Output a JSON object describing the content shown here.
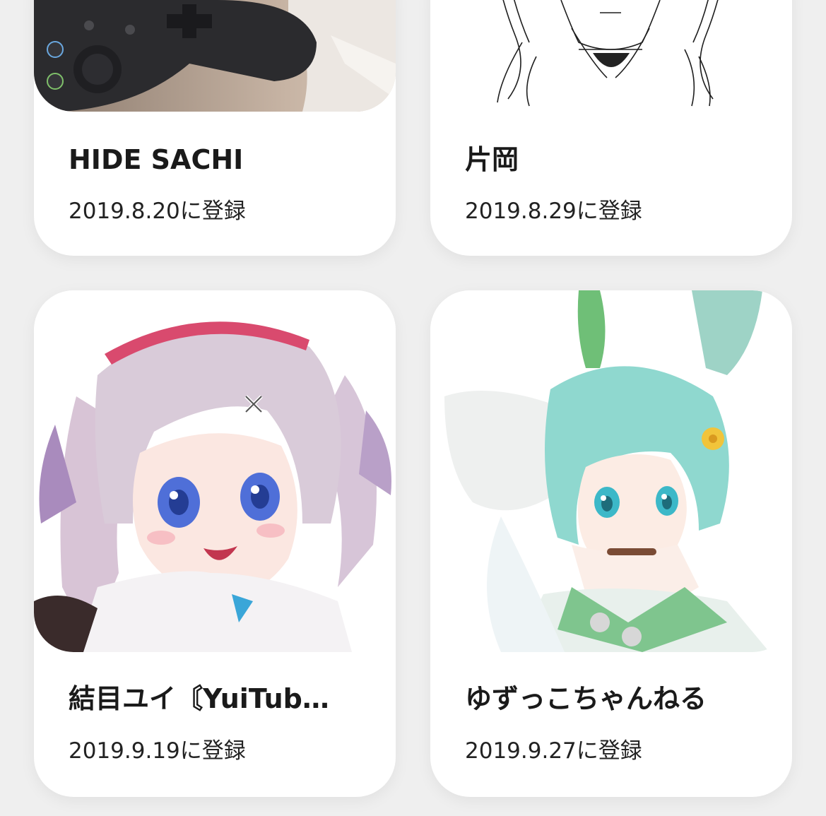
{
  "cards": [
    {
      "name": "HIDE SACHI",
      "registered": "2019.8.20に登録",
      "thumbnail": "gamepad-photo"
    },
    {
      "name": "片岡",
      "registered": "2019.8.29に登録",
      "thumbnail": "line-sketch"
    },
    {
      "name": "結目ユイ〘YuiTub…",
      "registered": "2019.9.19に登録",
      "thumbnail": "anime-girl-pink-hair"
    },
    {
      "name": "ゆずっこちゃんねる",
      "registered": "2019.9.27に登録",
      "thumbnail": "anime-girl-mint-hair"
    }
  ],
  "colors": {
    "background": "#efefef",
    "card": "#ffffff",
    "text": "#1a1a1a"
  }
}
